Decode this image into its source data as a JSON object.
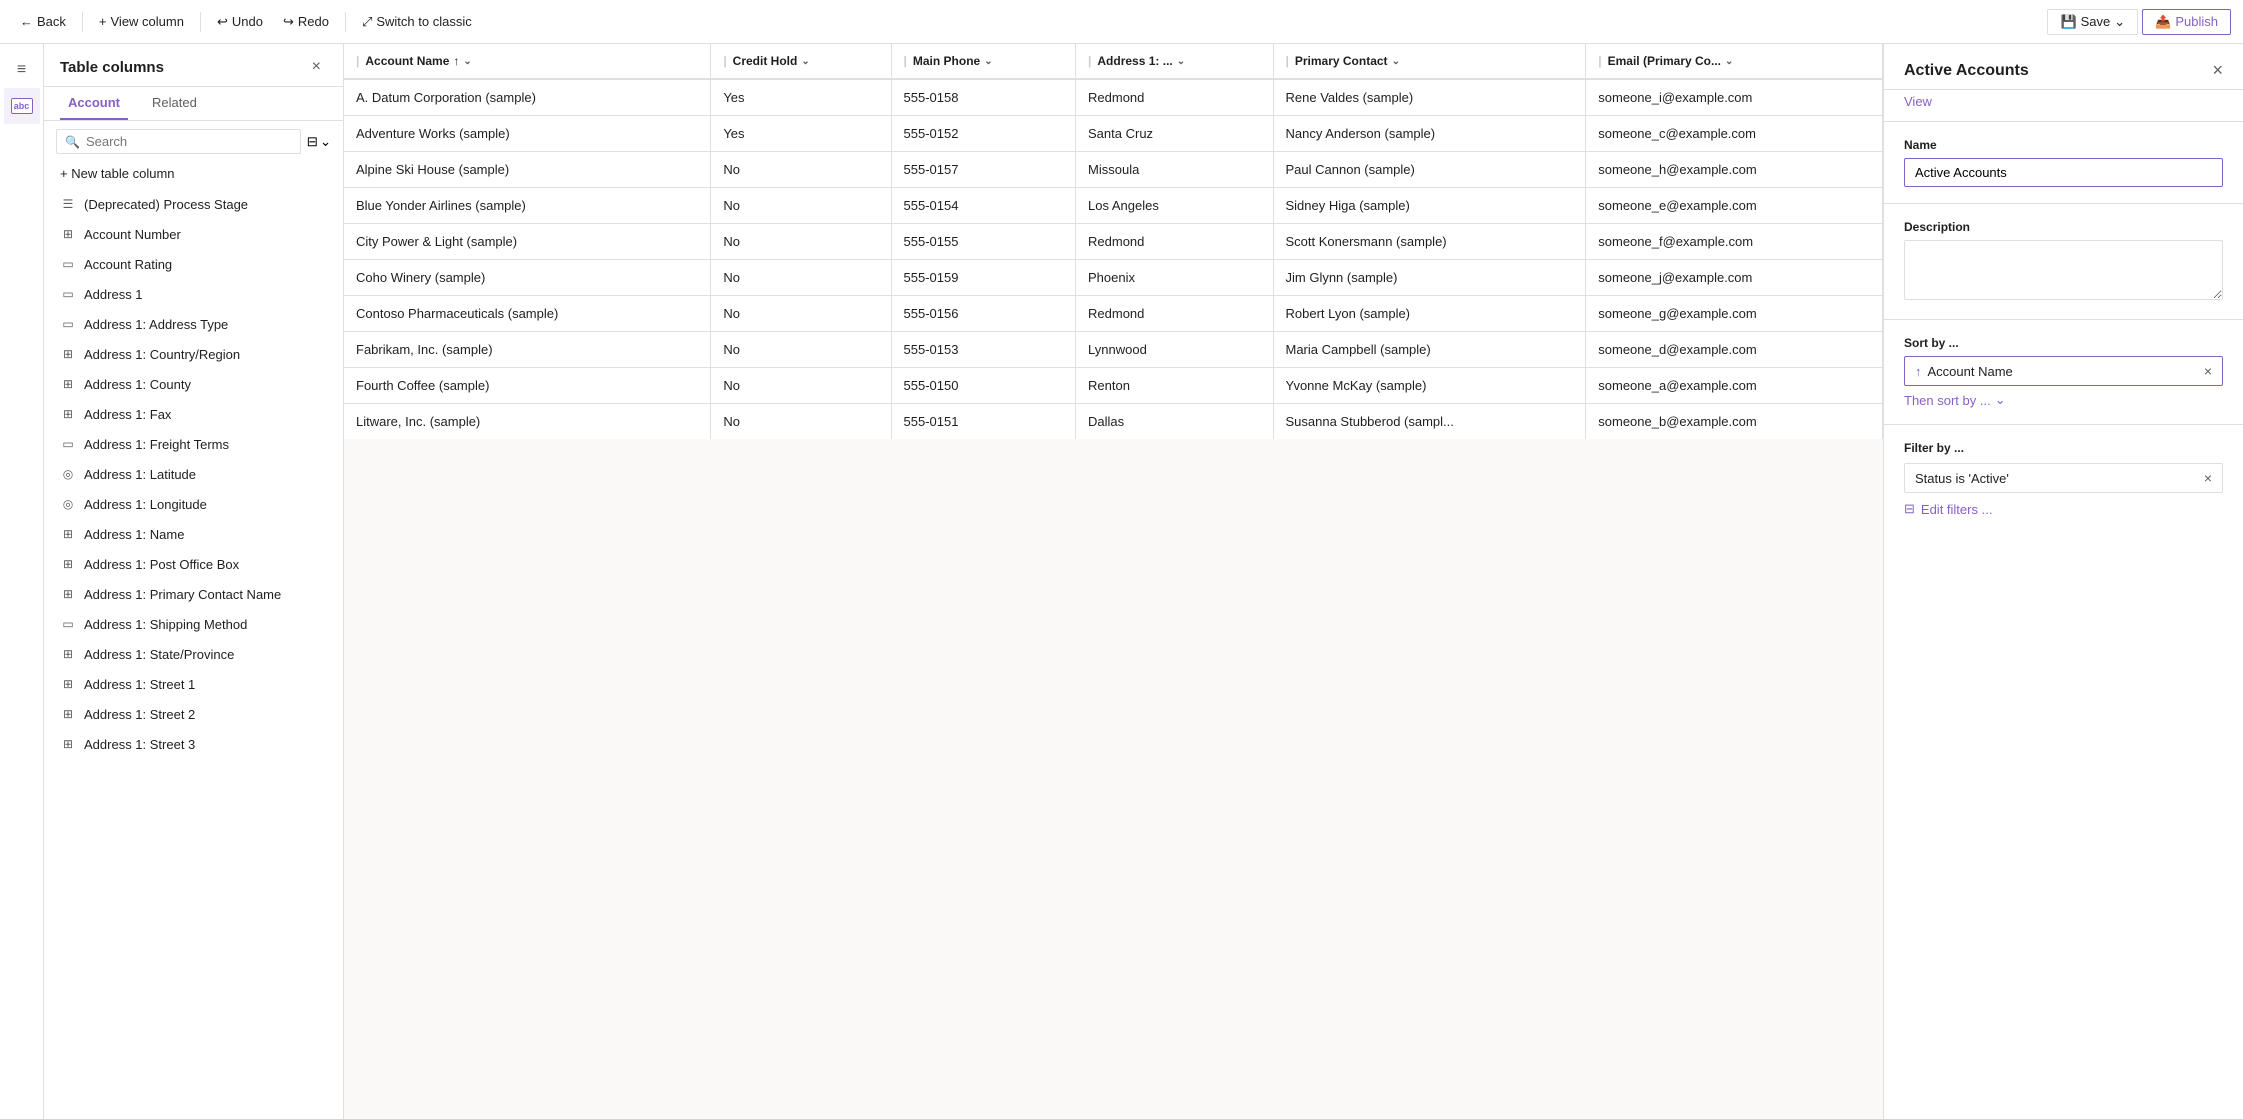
{
  "toolbar": {
    "back_label": "Back",
    "view_column_label": "View column",
    "undo_label": "Undo",
    "redo_label": "Redo",
    "switch_label": "Switch to classic",
    "save_label": "Save",
    "publish_label": "Publish"
  },
  "sidebar": {
    "title": "Table columns",
    "close_label": "×",
    "tabs": [
      {
        "id": "account",
        "label": "Account",
        "active": true
      },
      {
        "id": "related",
        "label": "Related",
        "active": false
      }
    ],
    "search_placeholder": "Search",
    "new_column_label": "+ New table column",
    "columns": [
      {
        "id": "deprecated-process-stage",
        "label": "(Deprecated) Process Stage",
        "icon": "list"
      },
      {
        "id": "account-number",
        "label": "Account Number",
        "icon": "grid"
      },
      {
        "id": "account-rating",
        "label": "Account Rating",
        "icon": "input"
      },
      {
        "id": "address-1",
        "label": "Address 1",
        "icon": "input"
      },
      {
        "id": "address-1-address-type",
        "label": "Address 1: Address Type",
        "icon": "input"
      },
      {
        "id": "address-1-country-region",
        "label": "Address 1: Country/Region",
        "icon": "grid"
      },
      {
        "id": "address-1-county",
        "label": "Address 1: County",
        "icon": "grid"
      },
      {
        "id": "address-1-fax",
        "label": "Address 1: Fax",
        "icon": "grid"
      },
      {
        "id": "address-1-freight-terms",
        "label": "Address 1: Freight Terms",
        "icon": "input"
      },
      {
        "id": "address-1-latitude",
        "label": "Address 1: Latitude",
        "icon": "globe"
      },
      {
        "id": "address-1-longitude",
        "label": "Address 1: Longitude",
        "icon": "globe"
      },
      {
        "id": "address-1-name",
        "label": "Address 1: Name",
        "icon": "grid"
      },
      {
        "id": "address-1-post-office-box",
        "label": "Address 1: Post Office Box",
        "icon": "grid"
      },
      {
        "id": "address-1-primary-contact-name",
        "label": "Address 1: Primary Contact Name",
        "icon": "grid"
      },
      {
        "id": "address-1-shipping-method",
        "label": "Address 1: Shipping Method",
        "icon": "input"
      },
      {
        "id": "address-1-state-province",
        "label": "Address 1: State/Province",
        "icon": "grid"
      },
      {
        "id": "address-1-street-1",
        "label": "Address 1: Street 1",
        "icon": "grid"
      },
      {
        "id": "address-1-street-2",
        "label": "Address 1: Street 2",
        "icon": "grid"
      },
      {
        "id": "address-1-street-3",
        "label": "Address 1: Street 3",
        "icon": "grid"
      }
    ]
  },
  "table": {
    "columns": [
      {
        "id": "account-name",
        "label": "Account Name",
        "sortable": true,
        "sort": "asc"
      },
      {
        "id": "credit-hold",
        "label": "Credit Hold",
        "sortable": true
      },
      {
        "id": "main-phone",
        "label": "Main Phone",
        "sortable": true
      },
      {
        "id": "address-1",
        "label": "Address 1: ...",
        "sortable": true
      },
      {
        "id": "primary-contact",
        "label": "Primary Contact",
        "sortable": true
      },
      {
        "id": "email-primary",
        "label": "Email (Primary Co...",
        "sortable": true
      }
    ],
    "rows": [
      {
        "account_name": "A. Datum Corporation (sample)",
        "credit_hold": "Yes",
        "main_phone": "555-0158",
        "address": "Redmond",
        "primary_contact": "Rene Valdes (sample)",
        "email": "someone_i@example.com"
      },
      {
        "account_name": "Adventure Works (sample)",
        "credit_hold": "Yes",
        "main_phone": "555-0152",
        "address": "Santa Cruz",
        "primary_contact": "Nancy Anderson (sample)",
        "email": "someone_c@example.com"
      },
      {
        "account_name": "Alpine Ski House (sample)",
        "credit_hold": "No",
        "main_phone": "555-0157",
        "address": "Missoula",
        "primary_contact": "Paul Cannon (sample)",
        "email": "someone_h@example.com"
      },
      {
        "account_name": "Blue Yonder Airlines (sample)",
        "credit_hold": "No",
        "main_phone": "555-0154",
        "address": "Los Angeles",
        "primary_contact": "Sidney Higa (sample)",
        "email": "someone_e@example.com"
      },
      {
        "account_name": "City Power & Light (sample)",
        "credit_hold": "No",
        "main_phone": "555-0155",
        "address": "Redmond",
        "primary_contact": "Scott Konersmann (sample)",
        "email": "someone_f@example.com"
      },
      {
        "account_name": "Coho Winery (sample)",
        "credit_hold": "No",
        "main_phone": "555-0159",
        "address": "Phoenix",
        "primary_contact": "Jim Glynn (sample)",
        "email": "someone_j@example.com"
      },
      {
        "account_name": "Contoso Pharmaceuticals (sample)",
        "credit_hold": "No",
        "main_phone": "555-0156",
        "address": "Redmond",
        "primary_contact": "Robert Lyon (sample)",
        "email": "someone_g@example.com"
      },
      {
        "account_name": "Fabrikam, Inc. (sample)",
        "credit_hold": "No",
        "main_phone": "555-0153",
        "address": "Lynnwood",
        "primary_contact": "Maria Campbell (sample)",
        "email": "someone_d@example.com"
      },
      {
        "account_name": "Fourth Coffee (sample)",
        "credit_hold": "No",
        "main_phone": "555-0150",
        "address": "Renton",
        "primary_contact": "Yvonne McKay (sample)",
        "email": "someone_a@example.com"
      },
      {
        "account_name": "Litware, Inc. (sample)",
        "credit_hold": "No",
        "main_phone": "555-0151",
        "address": "Dallas",
        "primary_contact": "Susanna Stubberod (sampl...",
        "email": "someone_b@example.com"
      }
    ]
  },
  "right_panel": {
    "title": "Active Accounts",
    "close_label": "×",
    "view_label": "View",
    "name_label": "Name",
    "name_value": "Active Accounts",
    "description_label": "Description",
    "description_placeholder": "",
    "sort_label": "Sort by ...",
    "sort_field": "Account Name",
    "sort_remove": "×",
    "then_sort_label": "Then sort by ...",
    "filter_label": "Filter by ...",
    "filter_value": "Status is 'Active'",
    "filter_remove": "×",
    "edit_filters_label": "Edit filters ..."
  },
  "icons": {
    "back": "←",
    "view_column": "+",
    "undo": "↩",
    "redo": "↪",
    "switch": "⤢",
    "save": "💾",
    "publish": "📤",
    "search": "🔍",
    "filter": "⊟",
    "chevron_down": "⌄",
    "sort_asc": "↑",
    "sort_desc": "↓",
    "close": "×",
    "list_icon": "☰",
    "grid_icon": "⊞",
    "input_icon": "▭",
    "globe_icon": "◎",
    "nav_menu": "≡",
    "nav_abc": "abc"
  }
}
